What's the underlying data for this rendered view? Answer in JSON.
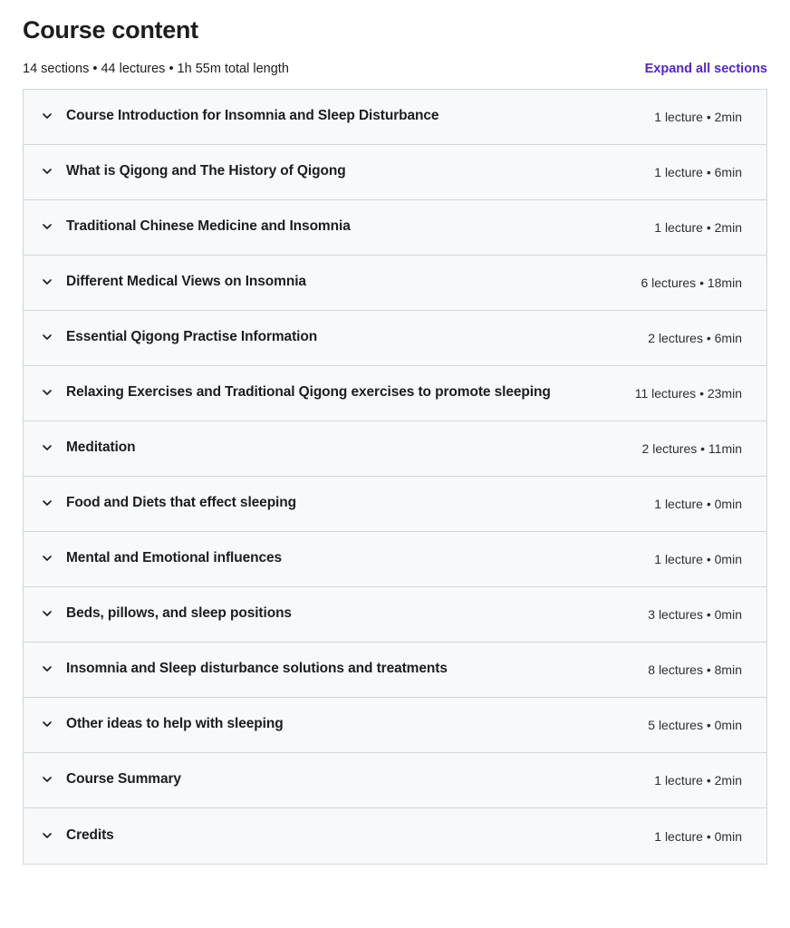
{
  "header": {
    "title": "Course content",
    "summary": "14 sections • 44 lectures • 1h 55m total length",
    "expand_all_label": "Expand all sections",
    "accent_color": "#5624d0"
  },
  "colors": {
    "row_background": "#f7f9fa",
    "border": "#d1d7dc",
    "text": "#1c1d1f",
    "link": "#5624d0"
  },
  "sections": [
    {
      "title": "Course Introduction for Insomnia and Sleep Disturbance",
      "meta": "1 lecture • 2min"
    },
    {
      "title": "What is Qigong and The History of Qigong",
      "meta": "1 lecture • 6min"
    },
    {
      "title": "Traditional Chinese Medicine and Insomnia",
      "meta": "1 lecture • 2min"
    },
    {
      "title": "Different Medical Views on Insomnia",
      "meta": "6 lectures • 18min"
    },
    {
      "title": "Essential Qigong Practise Information",
      "meta": "2 lectures • 6min"
    },
    {
      "title": "Relaxing Exercises and Traditional Qigong exercises to promote sleeping",
      "meta": "11 lectures • 23min"
    },
    {
      "title": "Meditation",
      "meta": "2 lectures • 11min"
    },
    {
      "title": "Food and Diets that effect sleeping",
      "meta": "1 lecture • 0min"
    },
    {
      "title": "Mental and Emotional influences",
      "meta": "1 lecture • 0min"
    },
    {
      "title": "Beds, pillows, and sleep positions",
      "meta": "3 lectures • 0min"
    },
    {
      "title": "Insomnia and Sleep disturbance solutions and treatments",
      "meta": "8 lectures • 8min"
    },
    {
      "title": "Other ideas to help with sleeping",
      "meta": "5 lectures • 0min"
    },
    {
      "title": "Course Summary",
      "meta": "1 lecture • 2min"
    },
    {
      "title": "Credits",
      "meta": "1 lecture • 0min"
    }
  ]
}
